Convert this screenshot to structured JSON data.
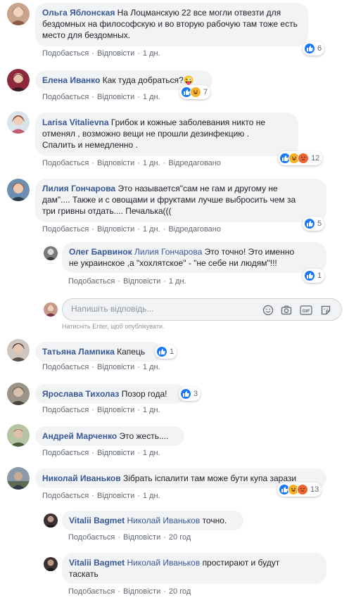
{
  "actions": {
    "like": "Подобається",
    "reply": "Відповісти",
    "edited": "Відредаговано",
    "sep": "·"
  },
  "composer": {
    "placeholder": "Напишіть відповідь...",
    "hint": "Натисніть Enter, щоб опублікувати."
  },
  "comments": [
    {
      "author": "Ольга Яблонская",
      "line1": "На Лоцманскую 22 все могли отвезти для",
      "line2": "бездомных на философскую и во вторую рабочую там тоже есть",
      "line3": "место для бездомных.",
      "time": "1 дн.",
      "reactions": [
        "like"
      ],
      "count": "6"
    },
    {
      "author": "Елена Иванко",
      "text": "Как туда добраться?😜",
      "time": "1 дн.",
      "reactions": [
        "like",
        "haha"
      ],
      "count": "7"
    },
    {
      "author": "Larisa Vitalievna",
      "line1": "Грибок и кожные заболевания никто не",
      "line2": "отменял , возможно вещи не прошли дезинфекцию .",
      "line3": "Спалить и немедленно .",
      "time": "1 дн.",
      "edited": true,
      "reactions": [
        "like",
        "haha",
        "angry"
      ],
      "count": "12"
    },
    {
      "author": "Лилия Гончарова",
      "line1": "Это называется\"сам не гам и другому не",
      "line2": "дам\".... Также и с овощами и фруктами лучше выбросить чем за",
      "line3": "три гривны отдать.... Печалька(((",
      "time": "1 дн.",
      "edited": true,
      "reactions": [
        "like"
      ],
      "count": "5"
    },
    {
      "author": "Олег Барвинок",
      "mention": "Лилия Гончарова",
      "line1": "Это точно! Это именно",
      "line2": "не украинское ,а \"хохлятское\" - \"не себе ни людям\"!!!",
      "time": "1 дн.",
      "reactions": [
        "like"
      ],
      "count": "1"
    },
    {
      "author": "Татьяна Лампика",
      "text": "Капець",
      "time": "1 дн.",
      "reactions": [
        "like"
      ],
      "count": "1"
    },
    {
      "author": "Ярослава Тихолаз",
      "text": "Позор года!",
      "time": "1 дн.",
      "reactions": [
        "like"
      ],
      "count": "3"
    },
    {
      "author": "Андрей Марченко",
      "text": "Это жесть....",
      "time": "1 дн."
    },
    {
      "author": "Николай Иваньков",
      "text": "Зібрать іспалити там може бути купа зарази",
      "time": "1 дн.",
      "reactions": [
        "like",
        "haha",
        "angry"
      ],
      "count": "13"
    },
    {
      "author": "Vitalii Bagmet",
      "mention": "Николай Иваньков",
      "text": "точно.",
      "time": "20 год"
    },
    {
      "author": "Vitalii Bagmet",
      "mention": "Николай Иваньков",
      "line1": "простирают и будут",
      "line2": "таскать",
      "time": "20 год"
    }
  ]
}
